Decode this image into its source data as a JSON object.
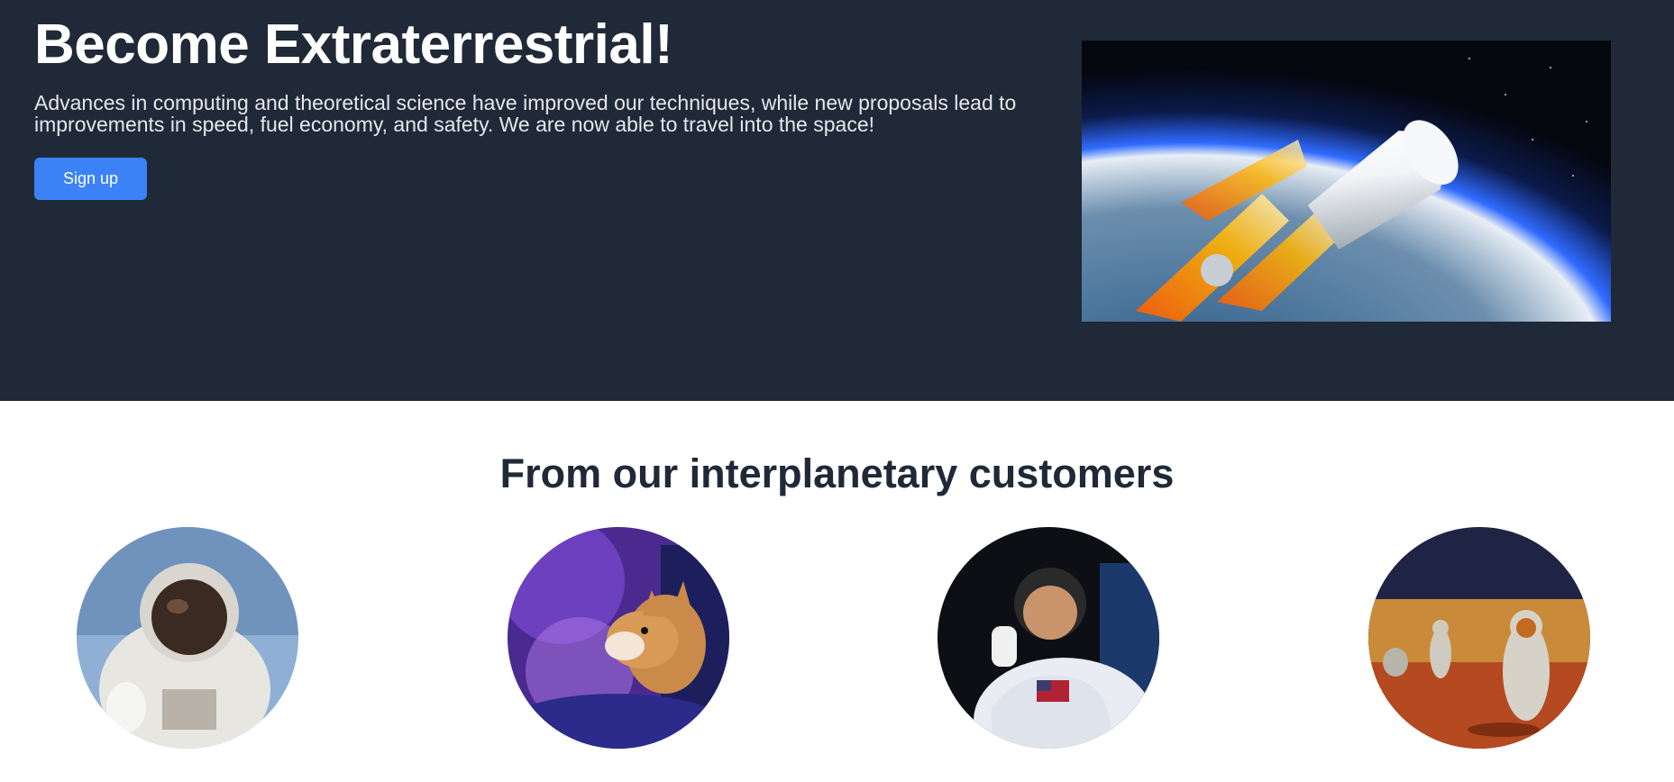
{
  "hero": {
    "title": "Become Extraterrestrial!",
    "subtitle": "Advances in computing and theoretical science have improved our techniques, while new proposals lead to improvements in speed, fuel economy, and safety. We are now able to travel into the space!",
    "signup_label": "Sign up",
    "image": "spacecraft-launch-image"
  },
  "customers": {
    "title": "From our interplanetary customers",
    "avatars": [
      {
        "image": "astronaut-spacewalk-photo"
      },
      {
        "image": "corgi-in-space-photo"
      },
      {
        "image": "astronaut-thumbs-up-photo"
      },
      {
        "image": "astronauts-on-mars-photo"
      }
    ]
  },
  "colors": {
    "hero_bg": "#1f2937",
    "accent": "#3b82f6",
    "heading_dark": "#1f2937"
  }
}
